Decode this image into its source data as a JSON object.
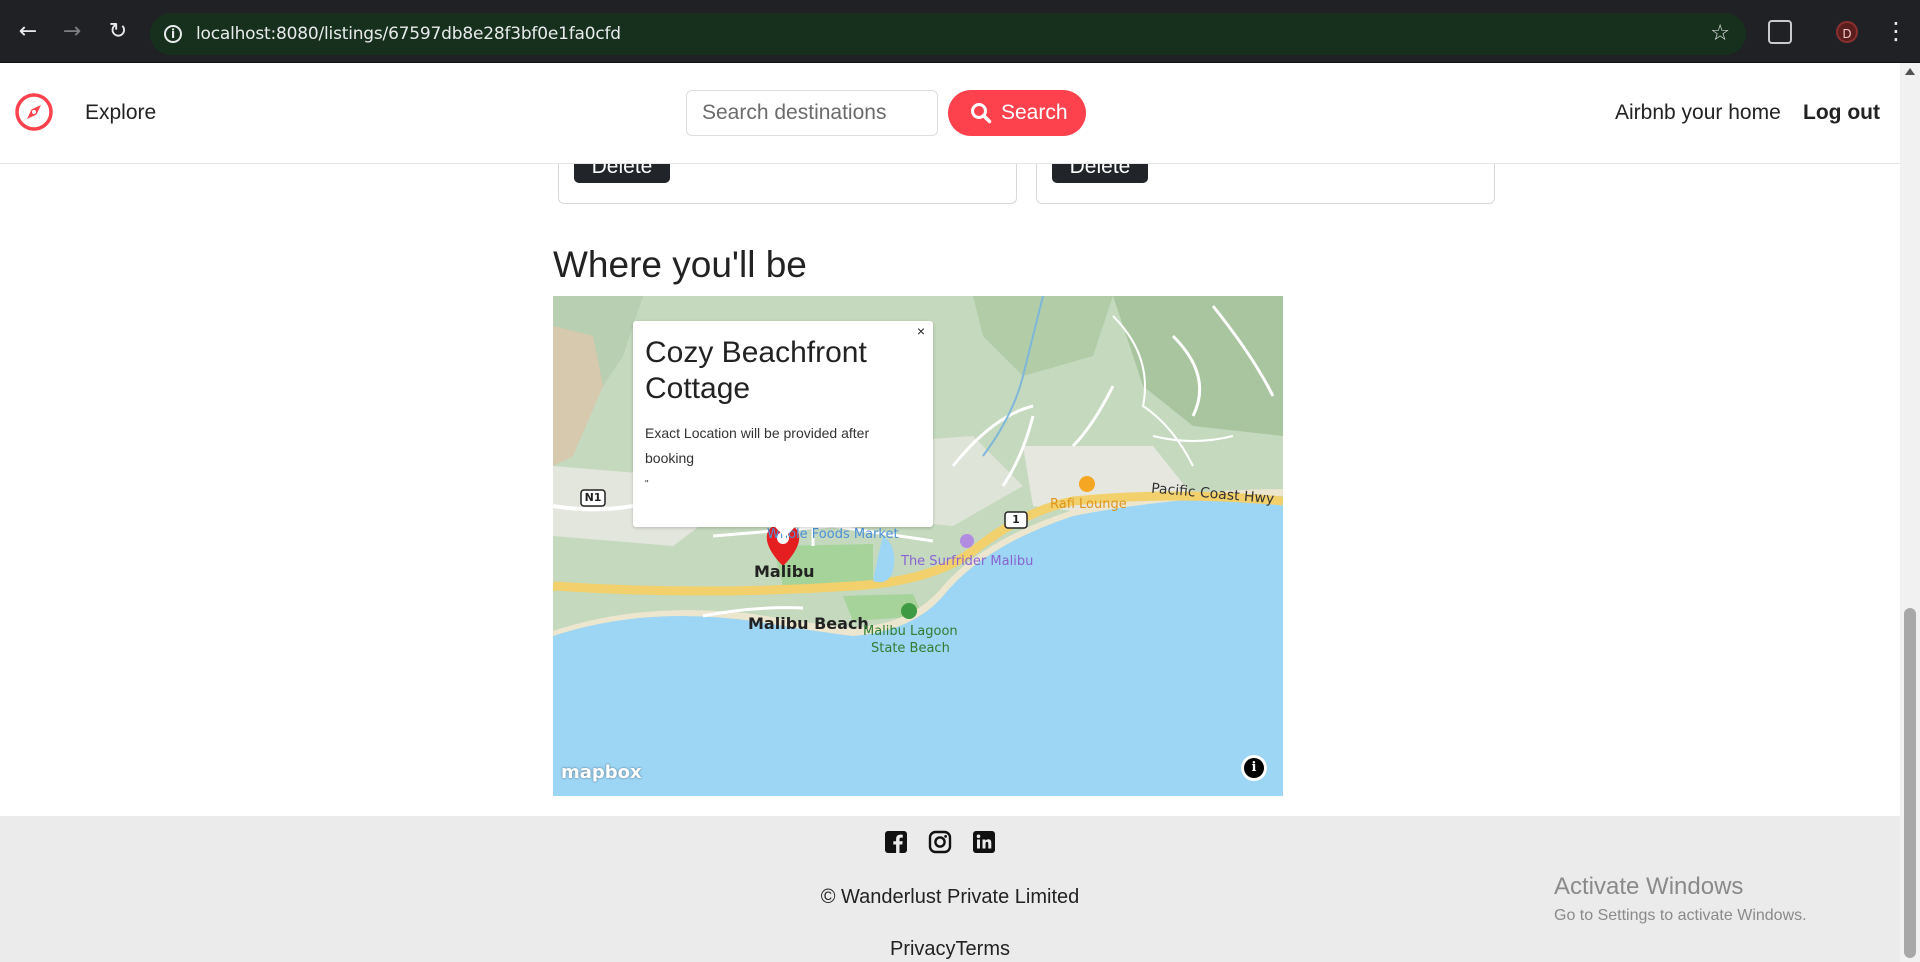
{
  "browser": {
    "url": "localhost:8080/listings/67597db8e28f3bf0e1fa0cfd",
    "back_icon": "arrow-left-icon",
    "forward_icon": "arrow-right-icon",
    "reload_icon": "reload-icon",
    "profile_initial": "D"
  },
  "navbar": {
    "explore_label": "Explore",
    "search_placeholder": "Search destinations",
    "search_button_label": "Search",
    "host_link_label": "Airbnb your home",
    "logout_label": "Log out",
    "brand_color": "#fe424d"
  },
  "reviews": [
    {
      "delete_label": "Delete"
    },
    {
      "delete_label": "Delete"
    }
  ],
  "location_section": {
    "title": "Where you'll be"
  },
  "map": {
    "popup_title": "Cozy Beachfront Cottage",
    "popup_text": "Exact Location will be provided after booking",
    "popup_extra": "\"",
    "popup_close": "×",
    "labels": {
      "malibu": "Malibu",
      "malibu_beach": "Malibu Beach",
      "lagoon_1": "Malibu Lagoon",
      "lagoon_2": "State Beach",
      "surfrider": "The Surfrider Malibu",
      "whole_foods": "Whole Foods Market",
      "rafi_lounge": "Rafi Lounge",
      "pch": "Pacific Coast Hwy",
      "route_n1": "N1",
      "route_1": "1"
    },
    "attribution": "mapbox",
    "info_symbol": "i"
  },
  "footer": {
    "copyright": "© Wanderlust Private Limited",
    "links": "PrivacyTerms",
    "social_icons": [
      "facebook-icon",
      "instagram-icon",
      "linkedin-icon"
    ]
  },
  "watermark": {
    "line1": "Activate Windows",
    "line2": "Go to Settings to activate Windows."
  }
}
